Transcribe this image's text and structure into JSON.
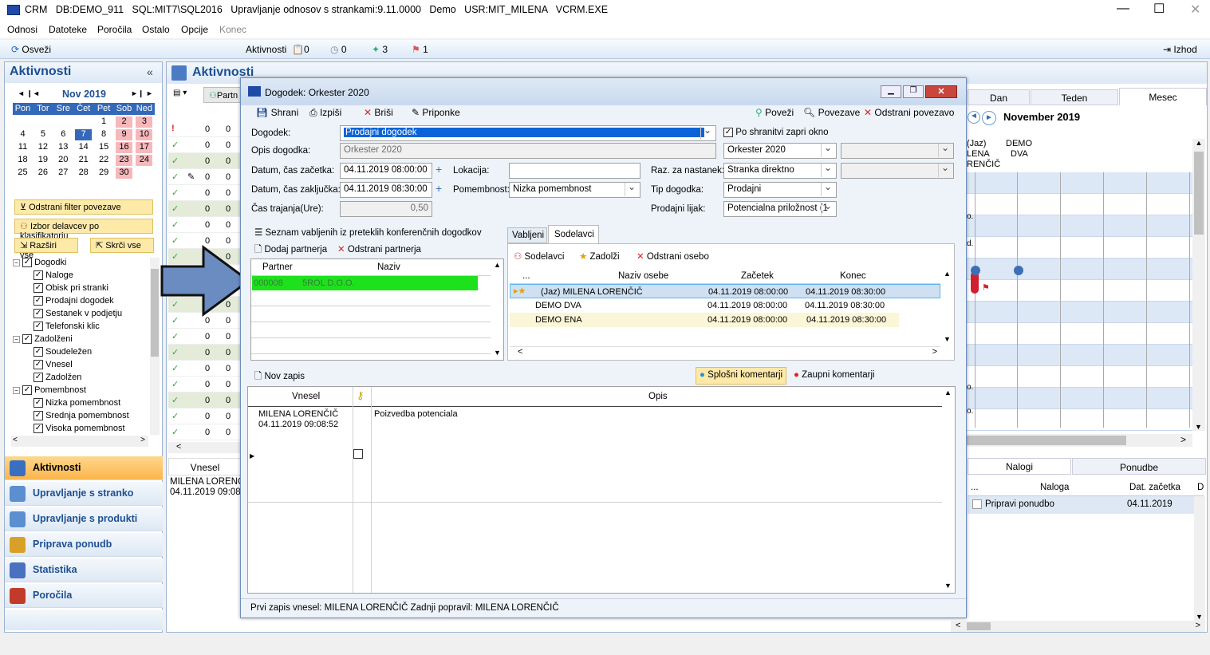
{
  "app": {
    "title": "CRM   DB:DEMO_911   SQL:MIT7\\SQL2016   Upravljanje odnosov s strankami:9.11.0000   Demo   USR:MIT_MILENA   VCRM.EXE"
  },
  "menu": [
    "Odnosi",
    "Datoteke",
    "Poročila",
    "Ostalo",
    "Opcije",
    "Konec"
  ],
  "toolbar": {
    "refresh": "Osveži",
    "activities_label": "Aktivnosti",
    "c1": "0",
    "c2": "0",
    "c3": "3",
    "c4": "1",
    "exit": "Izhod"
  },
  "left": {
    "header": "Aktivnosti",
    "cal_month": "Nov 2019",
    "days": [
      "Pon",
      "Tor",
      "Sre",
      "Čet",
      "Pet",
      "Sob",
      "Ned"
    ],
    "weeks": [
      [
        "",
        "",
        "",
        "",
        "1",
        "2",
        "3"
      ],
      [
        "4",
        "5",
        "6",
        "7",
        "8",
        "9",
        "10"
      ],
      [
        "11",
        "12",
        "13",
        "14",
        "15",
        "16",
        "17"
      ],
      [
        "18",
        "19",
        "20",
        "21",
        "22",
        "23",
        "24"
      ],
      [
        "25",
        "26",
        "27",
        "28",
        "29",
        "30",
        ""
      ]
    ],
    "btn_filter": "Odstrani filter povezave",
    "btn_izbor": "Izbor delavcev po klasifikatorju",
    "btn_expand": "Razširi vse",
    "btn_collapse": "Skrči vse",
    "tree": [
      {
        "t": "Dogodki",
        "l": 0
      },
      {
        "t": "Naloge",
        "l": 1
      },
      {
        "t": "Obisk pri stranki",
        "l": 1
      },
      {
        "t": "Prodajni dogodek",
        "l": 1
      },
      {
        "t": "Sestanek v podjetju",
        "l": 1
      },
      {
        "t": "Telefonski klic",
        "l": 1
      },
      {
        "t": "Zadolženi",
        "l": 0
      },
      {
        "t": "Soudeležen",
        "l": 1
      },
      {
        "t": "Vnesel",
        "l": 1
      },
      {
        "t": "Zadolžen",
        "l": 1
      },
      {
        "t": "Pomembnost",
        "l": 0
      },
      {
        "t": "Nizka pomembnost",
        "l": 1
      },
      {
        "t": "Srednja pomembnost",
        "l": 1
      },
      {
        "t": "Visoka pomembnost",
        "l": 1
      }
    ],
    "nav": [
      "Aktivnosti",
      "Upravljanje s stranko",
      "Upravljanje s produkti",
      "Priprava ponudb",
      "Statistika",
      "Poročila"
    ]
  },
  "main": {
    "header": "Aktivnosti",
    "partner_tab": "Partn",
    "col_vnesel": "Vnesel",
    "row_user": "MILENA LORENČI",
    "row_date": "04.11.2019 09:08:5",
    "zero": "0"
  },
  "right": {
    "tabs": [
      "Dan",
      "Teden",
      "Mesec"
    ],
    "month": "November 2019",
    "col1": "(Jaz) MILENA LORENČIČ",
    "col1a": "(Jaz)",
    "col1b": "LENA",
    "col1c": "RENČIČ",
    "col2a": "DEMO",
    "col2b": "DVA",
    "side_letters": [
      "o.",
      "d.",
      "o.",
      "o."
    ],
    "btabs": [
      "Nalogi",
      "Ponudbe"
    ],
    "bcols": [
      "...",
      "Naloga",
      "Dat. začetka",
      "D"
    ],
    "brow": {
      "naloga": "Pripravi ponudbo",
      "date": "04.11.2019"
    }
  },
  "dialog": {
    "title": "Dogodek: Orkester 2020",
    "save": "Shrani",
    "print": "Izpiši",
    "delete": "Briši",
    "attach": "Priponke",
    "link": "Poveži",
    "links": "Povezave",
    "unlink": "Odstrani povezavo",
    "l_dogodek": "Dogodek:",
    "v_dogodek": "Prodajni dogodek",
    "chk_close": "Po shranitvi zapri okno",
    "l_opis": "Opis dogodka:",
    "v_opis": "Orkester 2020",
    "v_opis2": "Orkester 2020",
    "l_start": "Datum, čas začetka:",
    "v_start": "04.11.2019 08:00:00",
    "l_lok": "Lokacija:",
    "l_raz": "Raz. za nastanek:",
    "v_raz": "Stranka direktno",
    "l_end": "Datum, čas zaključka:",
    "v_end": "04.11.2019 08:30:00",
    "l_pom": "Pomembnost:",
    "v_pom": "Nizka pomembnost",
    "l_tip": "Tip dogodka:",
    "v_tip": "Prodajni",
    "l_dur": "Čas trajanja(Ure):",
    "v_dur": "0,50",
    "l_lijak": "Prodajni lijak:",
    "v_lijak": "Potencialna priložnost (1",
    "seznam": "Seznam vabljenih iz preteklih konferenčnih dogodkov",
    "add_partner": "Dodaj partnerja",
    "rem_partner": "Odstrani partnerja",
    "p_cols": [
      "Partner",
      "Naziv"
    ],
    "p_row": [
      "000008",
      "5ROL D.O.O."
    ],
    "tabs": [
      "Vabljeni",
      "Sodelavci"
    ],
    "sodelavci": "Sodelavci",
    "zadolzi": "Zadolži",
    "odstrani_osebo": "Odstrani osebo",
    "s_cols": [
      "...",
      "Naziv osebe",
      "Začetek",
      "Konec"
    ],
    "s_rows": [
      [
        "(Jaz) MILENA LORENČIČ",
        "04.11.2019 08:00:00",
        "04.11.2019 08:30:00"
      ],
      [
        "DEMO DVA",
        "04.11.2019 08:00:00",
        "04.11.2019 08:30:00"
      ],
      [
        "DEMO ENA",
        "04.11.2019 08:00:00",
        "04.11.2019 08:30:00"
      ]
    ],
    "nov_zapis": "Nov zapis",
    "splosni": "Splošni komentarji",
    "zaupni": "Zaupni komentarji",
    "c_cols": [
      "Vnesel",
      "Opis"
    ],
    "c_user": "MILENA LORENČIČ",
    "c_date": "04.11.2019 09:08:52",
    "c_opis": "Poizvedba potenciala",
    "status": "Prvi zapis vnesel: MILENA LORENČIČ Zadnji popravil: MILENA LORENČIČ"
  }
}
